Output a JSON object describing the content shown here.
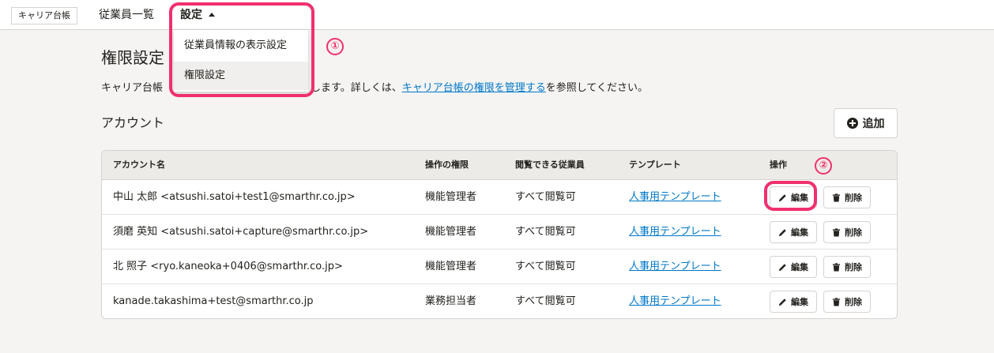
{
  "header": {
    "app_badge": "キャリア台帳",
    "nav_employees": "従業員一覧",
    "nav_settings": "設定"
  },
  "dropdown": {
    "items": [
      "従業員情報の表示設定",
      "権限設定"
    ]
  },
  "markers": [
    "①",
    "②"
  ],
  "page": {
    "title": "権限設定",
    "description_prefix": "キャリア台帳",
    "description_mid": "します。詳しくは、",
    "description_link": "キャリア台帳の権限を管理する",
    "description_suffix": "を参照してください。",
    "section_title": "アカウント",
    "add_label": "追加"
  },
  "table": {
    "headers": [
      "アカウント名",
      "操作の権限",
      "閲覧できる従業員",
      "テンプレート",
      "操作"
    ],
    "rows": [
      {
        "name": "中山 太郎 <atsushi.satoi+test1@smarthr.co.jp>",
        "permission": "機能管理者",
        "employees": "すべて閲覧可",
        "template": "人事用テンプレート"
      },
      {
        "name": "須磨 英知 <atsushi.satoi+capture@smarthr.co.jp>",
        "permission": "機能管理者",
        "employees": "すべて閲覧可",
        "template": "人事用テンプレート"
      },
      {
        "name": "北 照子 <ryo.kaneoka+0406@smarthr.co.jp>",
        "permission": "機能管理者",
        "employees": "すべて閲覧可",
        "template": "人事用テンプレート"
      },
      {
        "name": "kanade.takashima+test@smarthr.co.jp",
        "permission": "業務担当者",
        "employees": "すべて閲覧可",
        "template": "人事用テンプレート"
      }
    ],
    "edit_label": "編集",
    "delete_label": "削除"
  },
  "colors": {
    "highlight": "#f0306e",
    "link": "#0077c7",
    "background": "#f5f4f3"
  }
}
